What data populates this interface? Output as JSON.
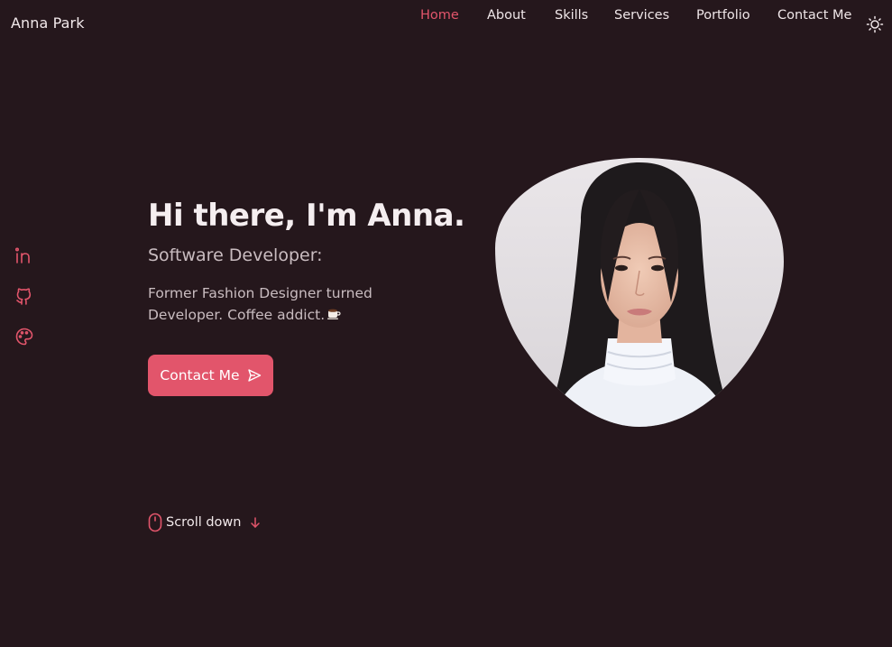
{
  "header": {
    "brand": "Anna Park",
    "nav": [
      {
        "label": "Home",
        "active": true
      },
      {
        "label": "About"
      },
      {
        "label": "Skills"
      },
      {
        "label": "Services"
      },
      {
        "label": "Portfolio"
      },
      {
        "label": "Contact Me"
      }
    ],
    "theme_toggle_icon": "sun-icon"
  },
  "social": [
    {
      "icon": "linkedin-icon"
    },
    {
      "icon": "github-icon"
    },
    {
      "icon": "palette-icon"
    }
  ],
  "hero": {
    "title": "Hi there, I'm Anna.",
    "subtitle": "Software Developer:",
    "description": "Former Fashion Designer turned Developer. Coffee addict.",
    "description_icon": "coffee-icon",
    "button_label": "Contact Me",
    "button_icon": "send-icon",
    "scroll_label": "Scroll down",
    "scroll_icons": [
      "mouse-icon",
      "arrow-down-icon"
    ]
  },
  "colors": {
    "background": "#25171c",
    "accent": "#e2556b",
    "text": "#efe6e8",
    "muted": "#c9bcc0"
  }
}
